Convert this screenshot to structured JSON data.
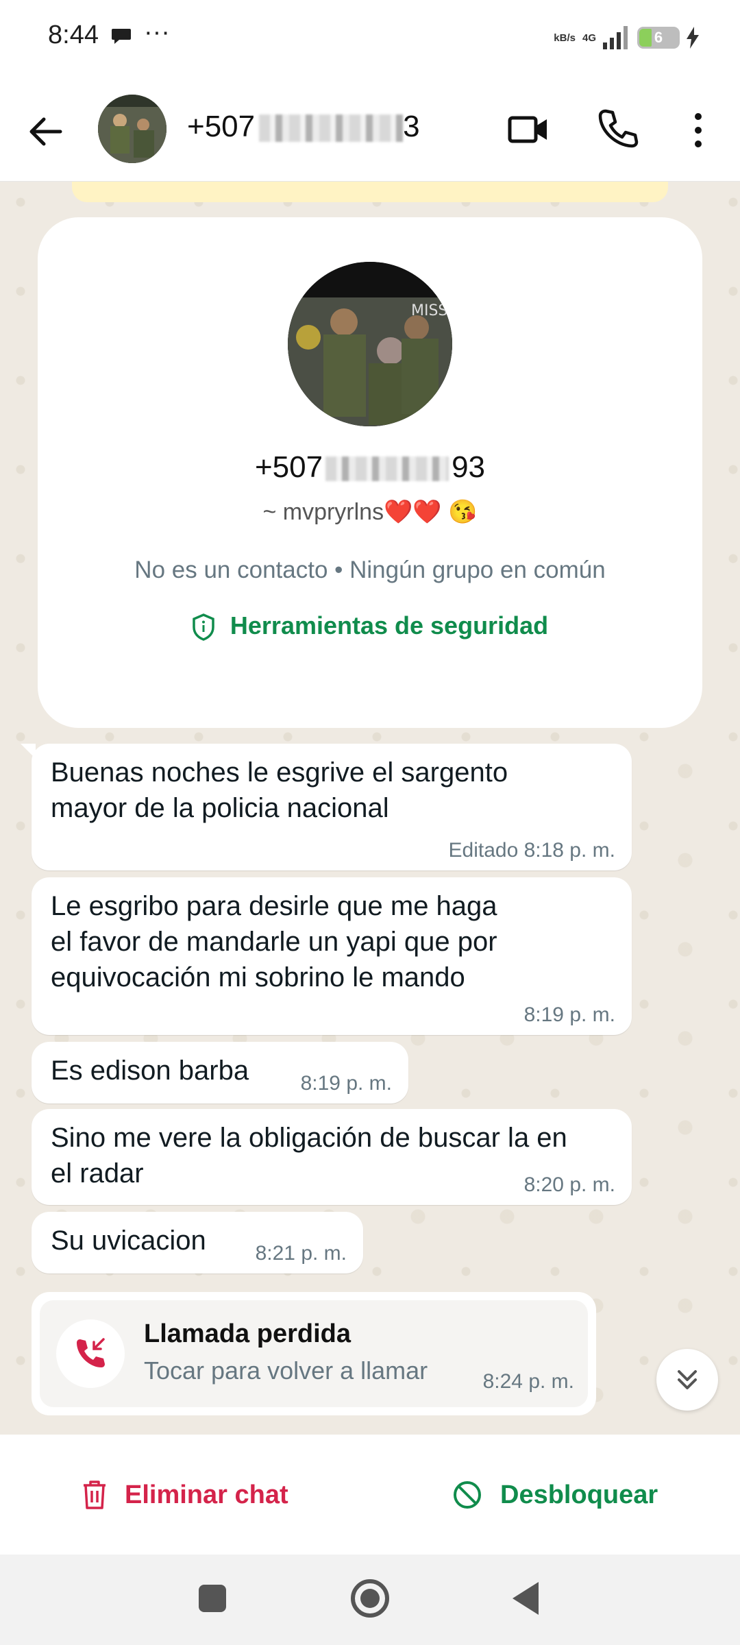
{
  "status_bar": {
    "time": "8:44",
    "dots": "···",
    "net_speed_top": "",
    "net_speed_bottom": "kB/s",
    "network": "4G",
    "battery": "6"
  },
  "header": {
    "title_visible": "+507",
    "title_suffix": "3"
  },
  "profile": {
    "number_prefix": "+507",
    "number_suffix": "93",
    "alias": "~ mvpryrlns❤️❤️ 😘",
    "info": "No es un contacto • Ningún grupo en común",
    "safety_tools": "Herramientas de seguridad"
  },
  "messages": [
    {
      "text": "Buenas noches le esgrive el  sargento\nmayor de la policia nacional",
      "time": "Editado 8:18 p. m."
    },
    {
      "text": "Le esgribo para desirle que me haga\nel favor de mandarle un yapi que por\nequivocación mi sobrino le mando",
      "time": "8:19 p. m."
    },
    {
      "text": "Es edison barba",
      "time": "8:19 p. m."
    },
    {
      "text": "Sino me vere la obligación de buscar la en\nel radar",
      "time": "8:20 p. m."
    },
    {
      "text": "Su uvicacion",
      "time": "8:21 p. m."
    }
  ],
  "missed_call": {
    "title": "Llamada perdida",
    "subtitle": "Tocar para volver a llamar",
    "time": "8:24 p. m."
  },
  "actions": {
    "delete": "Eliminar chat",
    "unblock": "Desbloquear"
  },
  "colors": {
    "accent_green": "#108c4c",
    "danger_red": "#d4234a",
    "chat_background": "#efeae2"
  }
}
